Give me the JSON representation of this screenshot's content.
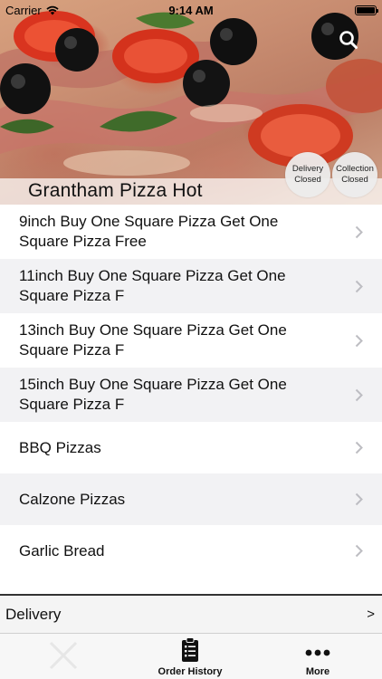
{
  "status_bar": {
    "carrier": "Carrier",
    "time": "9:14 AM",
    "battery_level": 1.0
  },
  "header": {
    "restaurant_name": "Grantham Pizza Hot",
    "search_icon": "search-icon",
    "badges": {
      "delivery": {
        "line1": "Delivery",
        "line2": "Closed"
      },
      "collection": {
        "line1": "Collection",
        "line2": "Closed"
      }
    }
  },
  "menu": {
    "items": [
      {
        "label": "9inch Buy One Square Pizza Get One Square Pizza Free"
      },
      {
        "label": "11inch Buy One Square Pizza Get One Square Pizza F"
      },
      {
        "label": "13inch Buy One Square Pizza Get One Square Pizza F"
      },
      {
        "label": "15inch Buy One Square Pizza Get One Square Pizza F"
      },
      {
        "label": "BBQ Pizzas"
      },
      {
        "label": "Calzone Pizzas"
      },
      {
        "label": "Garlic Bread"
      }
    ],
    "chevron_icon": "chevron-right-icon"
  },
  "delivery_bar": {
    "label": "Delivery",
    "arrow": ">"
  },
  "tab_bar": {
    "tabs": [
      {
        "label": "",
        "icon": "close-icon"
      },
      {
        "label": "Order History",
        "icon": "clipboard-list-icon"
      },
      {
        "label": "More",
        "icon": "more-dots-icon"
      }
    ]
  },
  "colors": {
    "row_alt_bg": "#f2f2f4",
    "badge_bg": "#ececec",
    "tab_bar_bg": "#f7f7f7",
    "chevron": "#bdbdc2"
  }
}
